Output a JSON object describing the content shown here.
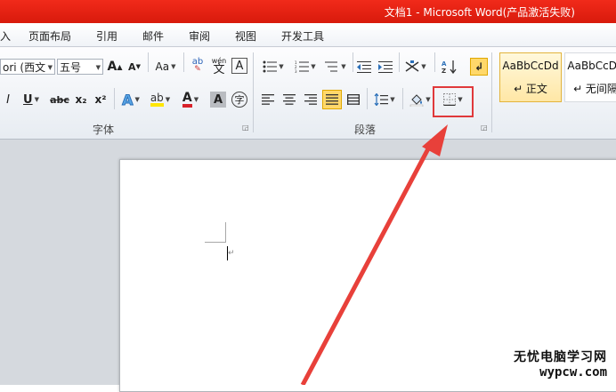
{
  "titlebar": {
    "title": "文档1 - Microsoft Word(产品激活失败)"
  },
  "tabs": [
    "入",
    "页面布局",
    "引用",
    "邮件",
    "审阅",
    "视图",
    "开发工具"
  ],
  "font": {
    "name_value": "ori (西文",
    "size_value": "五号",
    "grow_label": "A",
    "shrink_label": "A",
    "change_case_label": "Aa",
    "phonetic_label": "wén",
    "phonetic_char": "文",
    "char_border_label": "A",
    "italic_label": "I",
    "underline_label": "U",
    "strike_label": "abc",
    "sub_label": "x₂",
    "sup_label": "x²",
    "effects_label": "A",
    "font_color_label": "A",
    "char_shading_label": "A",
    "enclose_label": "字",
    "group_label": "字体"
  },
  "paragraph": {
    "group_label": "段落"
  },
  "styles": [
    {
      "sample": "AaBbCcDd",
      "name": "↵ 正文",
      "selected": true
    },
    {
      "sample": "AaBbCcDd",
      "name": "↵ 无间隔",
      "selected": false
    }
  ],
  "watermark": {
    "line1": "无忧电脑学习网",
    "line2": "wypcw.com"
  },
  "colors": {
    "titlebar": "#e8281a",
    "highlight": "#e0393b",
    "arrow": "#e8403a"
  }
}
